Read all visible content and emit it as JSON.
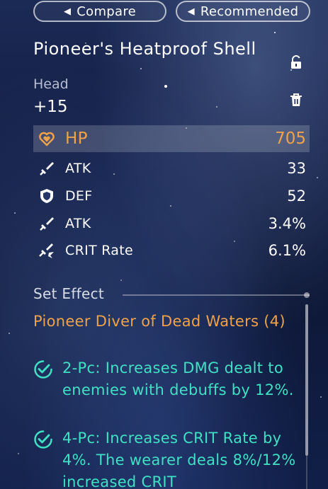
{
  "top_buttons": {
    "compare": "Compare",
    "recommended": "Recommended"
  },
  "relic": {
    "name": "Pioneer's Heatproof Shell",
    "slot": "Head",
    "level": "+15"
  },
  "main_stat": {
    "name": "HP",
    "value": "705",
    "icon": "heart-icon"
  },
  "sub_stats": [
    {
      "name": "ATK",
      "value": "33",
      "icon": "sword-icon"
    },
    {
      "name": "DEF",
      "value": "52",
      "icon": "shield-icon"
    },
    {
      "name": "ATK",
      "value": "3.4%",
      "icon": "sword-icon"
    },
    {
      "name": "CRIT Rate",
      "value": "6.1%",
      "icon": "crit-icon"
    }
  ],
  "set_effect": {
    "header": "Set Effect",
    "set_name": "Pioneer Diver of Dead Waters (4)",
    "effects": [
      {
        "text": "2-Pc: Increases DMG dealt to enemies with debuffs by 12%."
      },
      {
        "text": "4-Pc: Increases CRIT Rate by 4%. The wearer deals 8%/12% increased CRIT"
      }
    ]
  },
  "colors": {
    "accent_orange": "#f0a24a",
    "effect_teal": "#3fe0c4",
    "text_white": "#ffffff"
  }
}
